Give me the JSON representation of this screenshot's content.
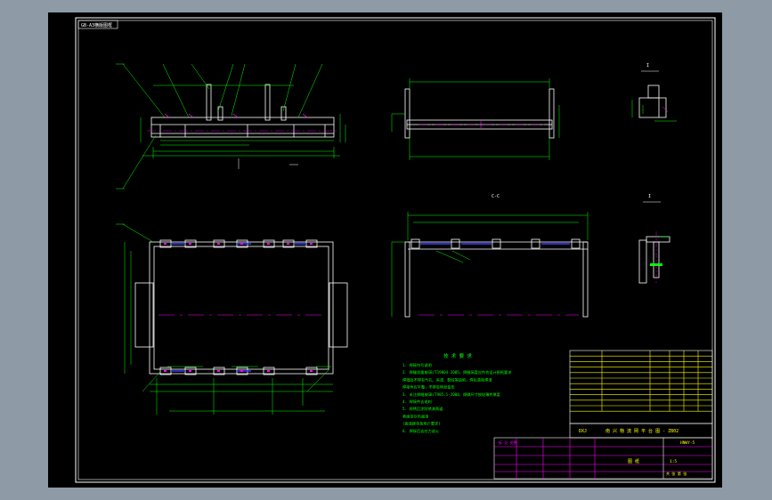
{
  "drawing": {
    "frame_label": "GB-A3横版图框",
    "section_label": "C-C",
    "detail_label_1": "I",
    "detail_label_2": "I",
    "title_block_heading": "标 记 处数",
    "title_project": "DXJ",
    "title_name": "南 兴 物 流 网 平 台 图 - ZB02",
    "title_drawing_no": "HNWY-5",
    "title_scale": "1:5",
    "title_sheet": "图 纸",
    "title_stage": "共 张 第 张"
  },
  "notes": {
    "heading": "技 术 要 求",
    "items": [
      "1. 焊接符号说明",
      "2. 焊缝质量按GB/T19804-2005，焊缝高度应符合设计图纸要求",
      "   焊缝处不得有气孔、夹渣、裂纹等缺陷，焊后清除焊渣",
      "   焊接件应平整，不得有明显变形",
      "3. 未注焊缝按GB/T985.1-2008，焊脚尺寸按较薄件厚度",
      "4. 焊接件去毛刺",
      "5. 除锈后涂防锈漆两道",
      "   表面涂灰色面漆",
      "   (面漆颜色按用户要求)",
      "6. 焊接后去应力退火"
    ]
  },
  "colors": {
    "background": "#000000",
    "outer": "#8e9aa6",
    "geometry": "#ffffff",
    "dimension": "#00ff00",
    "centerline": "#ff00ff",
    "hidden": "#0000ff",
    "titleblock": "#ffff00",
    "tableline": "#ff00ff"
  }
}
